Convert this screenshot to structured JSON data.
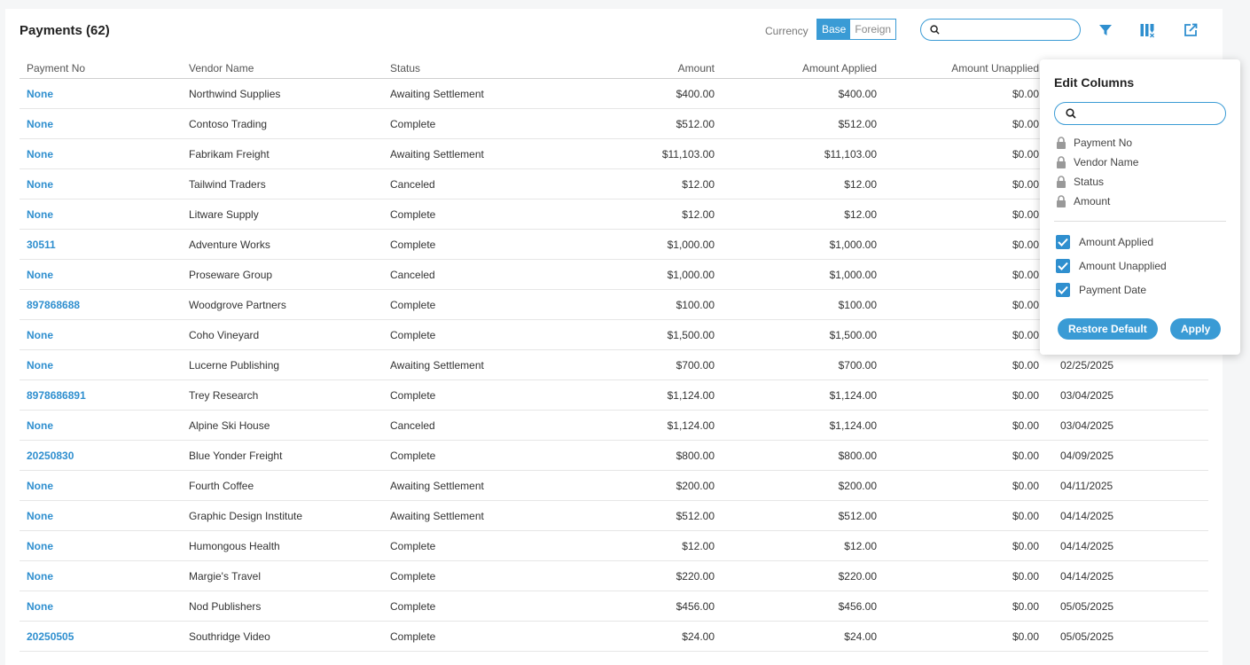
{
  "header": {
    "title": "Payments (62)"
  },
  "currency": {
    "label": "Currency",
    "options": [
      "Base",
      "Foreign"
    ],
    "selected": "Base"
  },
  "search": {
    "value": ""
  },
  "toolbar": {
    "icons": [
      "filter-icon",
      "columns-icon",
      "export-icon"
    ]
  },
  "table": {
    "columns": [
      "Payment No",
      "Vendor Name",
      "Status",
      "Amount",
      "Amount Applied",
      "Amount Unapplied",
      ""
    ],
    "rows": [
      [
        "None",
        "Northwind Supplies",
        "Awaiting Settlement",
        "$400.00",
        "$400.00",
        "$0.00",
        ""
      ],
      [
        "None",
        "Contoso Trading",
        "Complete",
        "$512.00",
        "$512.00",
        "$0.00",
        ""
      ],
      [
        "None",
        "Fabrikam Freight",
        "Awaiting Settlement",
        "$11,103.00",
        "$11,103.00",
        "$0.00",
        ""
      ],
      [
        "None",
        "Tailwind Traders",
        "Canceled",
        "$12.00",
        "$12.00",
        "$0.00",
        ""
      ],
      [
        "None",
        "Litware Supply",
        "Complete",
        "$12.00",
        "$12.00",
        "$0.00",
        ""
      ],
      [
        "30511",
        "Adventure Works",
        "Complete",
        "$1,000.00",
        "$1,000.00",
        "$0.00",
        ""
      ],
      [
        "None",
        "Proseware Group",
        "Canceled",
        "$1,000.00",
        "$1,000.00",
        "$0.00",
        ""
      ],
      [
        "897868688",
        "Woodgrove Partners",
        "Complete",
        "$100.00",
        "$100.00",
        "$0.00",
        ""
      ],
      [
        "None",
        "Coho Vineyard",
        "Complete",
        "$1,500.00",
        "$1,500.00",
        "$0.00",
        ""
      ],
      [
        "None",
        "Lucerne Publishing",
        "Awaiting Settlement",
        "$700.00",
        "$700.00",
        "$0.00",
        "02/25/2025"
      ],
      [
        "8978686891",
        "Trey Research",
        "Complete",
        "$1,124.00",
        "$1,124.00",
        "$0.00",
        "03/04/2025"
      ],
      [
        "None",
        "Alpine Ski House",
        "Canceled",
        "$1,124.00",
        "$1,124.00",
        "$0.00",
        "03/04/2025"
      ],
      [
        "20250830",
        "Blue Yonder Freight",
        "Complete",
        "$800.00",
        "$800.00",
        "$0.00",
        "04/09/2025"
      ],
      [
        "None",
        "Fourth Coffee",
        "Awaiting Settlement",
        "$200.00",
        "$200.00",
        "$0.00",
        "04/11/2025"
      ],
      [
        "None",
        "Graphic Design Institute",
        "Awaiting Settlement",
        "$512.00",
        "$512.00",
        "$0.00",
        "04/14/2025"
      ],
      [
        "None",
        "Humongous Health",
        "Complete",
        "$12.00",
        "$12.00",
        "$0.00",
        "04/14/2025"
      ],
      [
        "None",
        "Margie's Travel",
        "Complete",
        "$220.00",
        "$220.00",
        "$0.00",
        "04/14/2025"
      ],
      [
        "None",
        "Nod Publishers",
        "Complete",
        "$456.00",
        "$456.00",
        "$0.00",
        "05/05/2025"
      ],
      [
        "20250505",
        "Southridge Video",
        "Complete",
        "$24.00",
        "$24.00",
        "$0.00",
        "05/05/2025"
      ]
    ]
  },
  "edit_columns": {
    "title": "Edit Columns",
    "search_value": "",
    "locked": [
      "Payment No",
      "Vendor Name",
      "Status",
      "Amount"
    ],
    "toggles": [
      {
        "label": "Amount Applied",
        "checked": true
      },
      {
        "label": "Amount Unapplied",
        "checked": true
      },
      {
        "label": "Payment Date",
        "checked": true
      }
    ],
    "restore_label": "Restore Default",
    "apply_label": "Apply"
  },
  "colors": {
    "accent": "#3a9bd5",
    "link": "#2f8fcf"
  }
}
